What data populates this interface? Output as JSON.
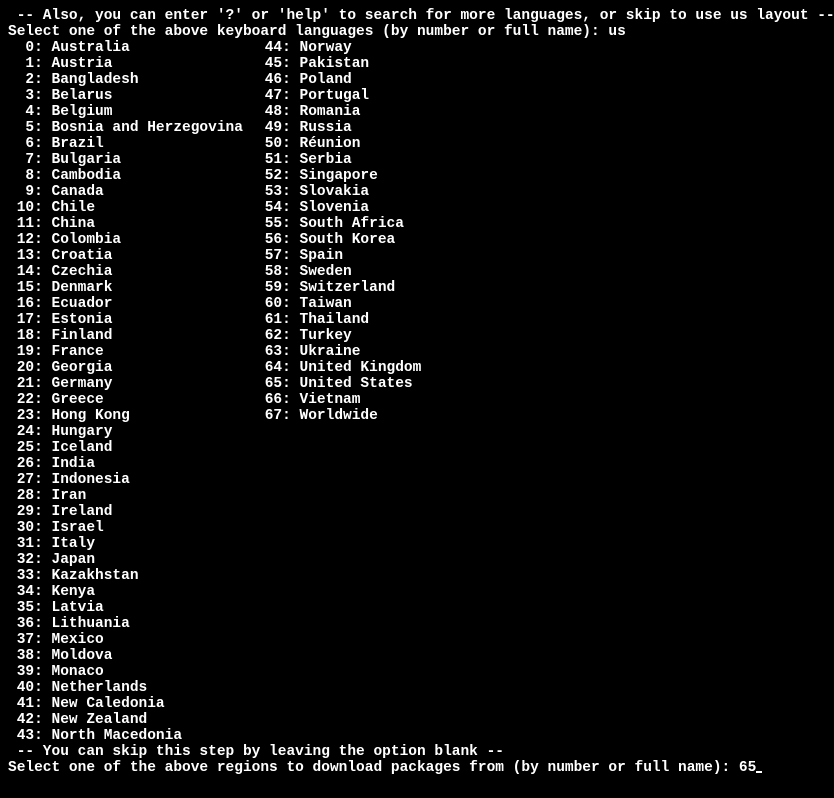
{
  "header": {
    "hint1": " -- Also, you can enter '?' or 'help' to search for more languages, or skip to use us layout --",
    "prompt1_label": "Select one of the above keyboard languages (by number or full name): ",
    "prompt1_value": "us"
  },
  "countries_col1": [
    {
      "num": "0",
      "name": "Australia"
    },
    {
      "num": "1",
      "name": "Austria"
    },
    {
      "num": "2",
      "name": "Bangladesh"
    },
    {
      "num": "3",
      "name": "Belarus"
    },
    {
      "num": "4",
      "name": "Belgium"
    },
    {
      "num": "5",
      "name": "Bosnia and Herzegovina"
    },
    {
      "num": "6",
      "name": "Brazil"
    },
    {
      "num": "7",
      "name": "Bulgaria"
    },
    {
      "num": "8",
      "name": "Cambodia"
    },
    {
      "num": "9",
      "name": "Canada"
    },
    {
      "num": "10",
      "name": "Chile"
    },
    {
      "num": "11",
      "name": "China"
    },
    {
      "num": "12",
      "name": "Colombia"
    },
    {
      "num": "13",
      "name": "Croatia"
    },
    {
      "num": "14",
      "name": "Czechia"
    },
    {
      "num": "15",
      "name": "Denmark"
    },
    {
      "num": "16",
      "name": "Ecuador"
    },
    {
      "num": "17",
      "name": "Estonia"
    },
    {
      "num": "18",
      "name": "Finland"
    },
    {
      "num": "19",
      "name": "France"
    },
    {
      "num": "20",
      "name": "Georgia"
    },
    {
      "num": "21",
      "name": "Germany"
    },
    {
      "num": "22",
      "name": "Greece"
    },
    {
      "num": "23",
      "name": "Hong Kong"
    },
    {
      "num": "24",
      "name": "Hungary"
    },
    {
      "num": "25",
      "name": "Iceland"
    },
    {
      "num": "26",
      "name": "India"
    },
    {
      "num": "27",
      "name": "Indonesia"
    },
    {
      "num": "28",
      "name": "Iran"
    },
    {
      "num": "29",
      "name": "Ireland"
    },
    {
      "num": "30",
      "name": "Israel"
    },
    {
      "num": "31",
      "name": "Italy"
    },
    {
      "num": "32",
      "name": "Japan"
    },
    {
      "num": "33",
      "name": "Kazakhstan"
    },
    {
      "num": "34",
      "name": "Kenya"
    },
    {
      "num": "35",
      "name": "Latvia"
    },
    {
      "num": "36",
      "name": "Lithuania"
    },
    {
      "num": "37",
      "name": "Mexico"
    },
    {
      "num": "38",
      "name": "Moldova"
    },
    {
      "num": "39",
      "name": "Monaco"
    },
    {
      "num": "40",
      "name": "Netherlands"
    },
    {
      "num": "41",
      "name": "New Caledonia"
    },
    {
      "num": "42",
      "name": "New Zealand"
    },
    {
      "num": "43",
      "name": "North Macedonia"
    }
  ],
  "countries_col2": [
    {
      "num": "44",
      "name": "Norway"
    },
    {
      "num": "45",
      "name": "Pakistan"
    },
    {
      "num": "46",
      "name": "Poland"
    },
    {
      "num": "47",
      "name": "Portugal"
    },
    {
      "num": "48",
      "name": "Romania"
    },
    {
      "num": "49",
      "name": "Russia"
    },
    {
      "num": "50",
      "name": "Réunion"
    },
    {
      "num": "51",
      "name": "Serbia"
    },
    {
      "num": "52",
      "name": "Singapore"
    },
    {
      "num": "53",
      "name": "Slovakia"
    },
    {
      "num": "54",
      "name": "Slovenia"
    },
    {
      "num": "55",
      "name": "South Africa"
    },
    {
      "num": "56",
      "name": "South Korea"
    },
    {
      "num": "57",
      "name": "Spain"
    },
    {
      "num": "58",
      "name": "Sweden"
    },
    {
      "num": "59",
      "name": "Switzerland"
    },
    {
      "num": "60",
      "name": "Taiwan"
    },
    {
      "num": "61",
      "name": "Thailand"
    },
    {
      "num": "62",
      "name": "Turkey"
    },
    {
      "num": "63",
      "name": "Ukraine"
    },
    {
      "num": "64",
      "name": "United Kingdom"
    },
    {
      "num": "65",
      "name": "United States"
    },
    {
      "num": "66",
      "name": "Vietnam"
    },
    {
      "num": "67",
      "name": "Worldwide"
    }
  ],
  "footer": {
    "hint2": " -- You can skip this step by leaving the option blank --",
    "prompt2_label": "Select one of the above regions to download packages from (by number or full name): ",
    "prompt2_value": "65"
  }
}
